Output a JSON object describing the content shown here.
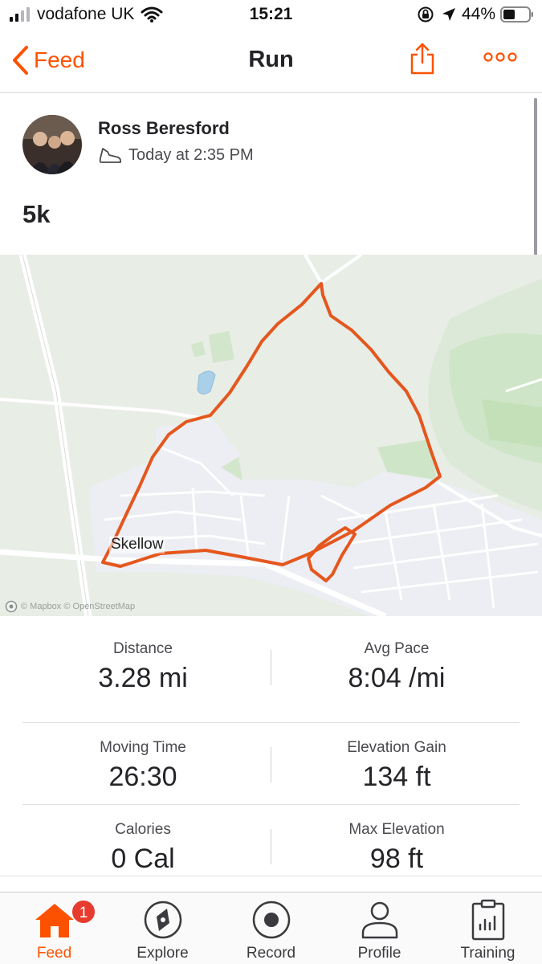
{
  "status_bar": {
    "carrier": "vodafone UK",
    "time": "15:21",
    "battery_percent": "44%"
  },
  "nav": {
    "back_label": "Feed",
    "title": "Run"
  },
  "activity": {
    "athlete_name": "Ross Beresford",
    "time": "Today at 2:35 PM",
    "title": "5k"
  },
  "map": {
    "place_label": "Skellow",
    "attribution": "© Mapbox © OpenStreetMap",
    "route_color": "#e4571e"
  },
  "stats": {
    "distance": {
      "label": "Distance",
      "value": "3.28 mi"
    },
    "avg_pace": {
      "label": "Avg Pace",
      "value": "8:04 /mi"
    },
    "moving_time": {
      "label": "Moving Time",
      "value": "26:30"
    },
    "elevation_gain": {
      "label": "Elevation Gain",
      "value": "134 ft"
    },
    "calories": {
      "label": "Calories",
      "value": "0 Cal"
    },
    "max_elevation": {
      "label": "Max Elevation",
      "value": "98 ft"
    }
  },
  "tabs": [
    {
      "label": "Feed",
      "icon": "home-icon",
      "active": true,
      "badge": "1"
    },
    {
      "label": "Explore",
      "icon": "compass-icon",
      "active": false
    },
    {
      "label": "Record",
      "icon": "record-icon",
      "active": false
    },
    {
      "label": "Profile",
      "icon": "person-icon",
      "active": false
    },
    {
      "label": "Training",
      "icon": "clipboard-chart-icon",
      "active": false
    }
  ],
  "colors": {
    "accent": "#fc5200",
    "badge": "#e63b2e"
  }
}
